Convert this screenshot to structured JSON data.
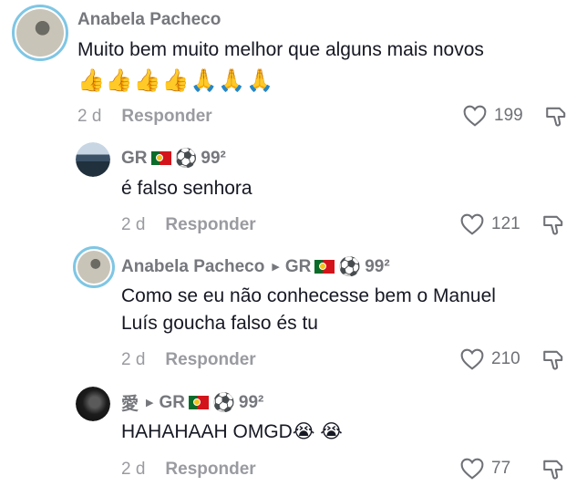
{
  "comments": [
    {
      "username": "Anabela Pacheco",
      "text_lines": [
        "Muito bem muito melhor que alguns mais novos"
      ],
      "emojis": "👍👍👍👍🙏🙏🙏",
      "date": "2 d",
      "reply_label": "Responder",
      "likes": "199"
    },
    {
      "username": "GR",
      "username_suffix": "99²",
      "text_lines": [
        "é falso senhora"
      ],
      "date": "2 d",
      "reply_label": "Responder",
      "likes": "121"
    },
    {
      "username": "Anabela Pacheco",
      "reply_to": "GR",
      "reply_to_suffix": "99²",
      "text_lines": [
        "Como se eu não conhecesse bem o Manuel",
        "Luís goucha falso és tu"
      ],
      "date": "2 d",
      "reply_label": "Responder",
      "likes": "210"
    },
    {
      "username": "愛",
      "reply_to": "GR",
      "reply_to_suffix": "99²",
      "text_lines": [
        "HAHAHAAH OMGD😭 😭"
      ],
      "date": "2 d",
      "reply_label": "Responder",
      "likes": "77"
    }
  ],
  "ball_glyph": "⚽",
  "icons": {
    "like": "heart-outline-icon",
    "dislike": "thumbs-down-outline-icon",
    "reply_arrow": "triangle-right-icon"
  }
}
